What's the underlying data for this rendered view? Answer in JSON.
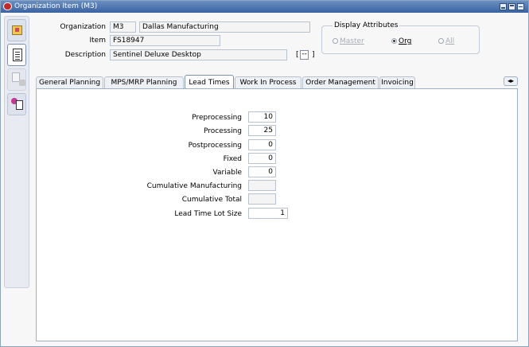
{
  "window": {
    "title": "Organization Item (M3)"
  },
  "header": {
    "organization_label": "Organization",
    "organization_code": "M3",
    "organization_name": "Dallas Manufacturing",
    "item_label": "Item",
    "item_value": "FS18947",
    "description_label": "Description",
    "description_value": "Sentinel Deluxe Desktop",
    "flex_open": "[",
    "flex_button": "--",
    "flex_close": "]"
  },
  "display_attributes": {
    "title": "Display Attributes",
    "options": [
      {
        "label": "Master",
        "selected": false,
        "enabled": false
      },
      {
        "label": "Org",
        "selected": true,
        "enabled": true
      },
      {
        "label": "All",
        "selected": false,
        "enabled": false
      }
    ]
  },
  "tabs": [
    {
      "label": "General Planning",
      "active": false
    },
    {
      "label": "MPS/MRP Planning",
      "active": false
    },
    {
      "label": "Lead Times",
      "active": true
    },
    {
      "label": "Work In Process",
      "active": false
    },
    {
      "label": "Order Management",
      "active": false
    },
    {
      "label": "Invoicing",
      "active": false
    }
  ],
  "tab_scroll_label": "◂▸",
  "lead_times": {
    "fields": [
      {
        "label": "Preprocessing",
        "value": "10"
      },
      {
        "label": "Processing",
        "value": "25"
      },
      {
        "label": "Postprocessing",
        "value": "0"
      },
      {
        "label": "Fixed",
        "value": "0"
      },
      {
        "label": "Variable",
        "value": "0"
      },
      {
        "label": "Cumulative Manufacturing",
        "value": ""
      },
      {
        "label": "Cumulative Total",
        "value": ""
      },
      {
        "label": "Lead Time Lot Size",
        "value": "1"
      }
    ]
  },
  "toolbar_icons": [
    "item-icon",
    "list-icon",
    "document-icon",
    "multi-list-icon"
  ],
  "colors": {
    "titlebar": "#3a62a2",
    "accent": "#7d93ad"
  }
}
